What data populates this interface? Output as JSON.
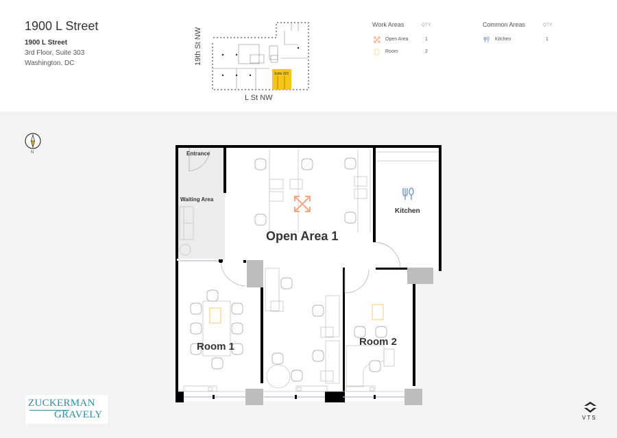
{
  "header": {
    "title": "1900 L Street",
    "address_name": "1900 L Street",
    "address_line": "3rd Floor, Suite 303",
    "city": "Washington, DC"
  },
  "keymap": {
    "street_left": "19th St NW",
    "street_bottom": "L St NW",
    "suite_label": "Suite 303",
    "highlight_color": "#f5c518"
  },
  "legend": {
    "work_areas": {
      "heading": "Work Areas",
      "qty_label": "QTY",
      "items": [
        {
          "icon": "open-area-icon",
          "label": "Open Area",
          "qty": "1",
          "color": "#f4a582"
        },
        {
          "icon": "room-icon",
          "label": "Room",
          "qty": "2",
          "color": "#f9dca0"
        }
      ]
    },
    "common_areas": {
      "heading": "Common Areas",
      "qty_label": "QTY",
      "items": [
        {
          "icon": "kitchen-icon",
          "label": "Kitchen",
          "qty": "1",
          "color": "#7a9cc6"
        }
      ]
    }
  },
  "compass": {
    "label": "N"
  },
  "floorplan": {
    "rooms": {
      "entrance": "Entrance",
      "waiting_area": "Waiting Area",
      "open_area": "Open Area 1",
      "kitchen": "Kitchen",
      "room1": "Room 1",
      "room2": "Room 2"
    }
  },
  "branding": {
    "broker_line1": "ZUCKERMAN",
    "broker_line2": "GRAVELY",
    "platform": "VTS"
  }
}
